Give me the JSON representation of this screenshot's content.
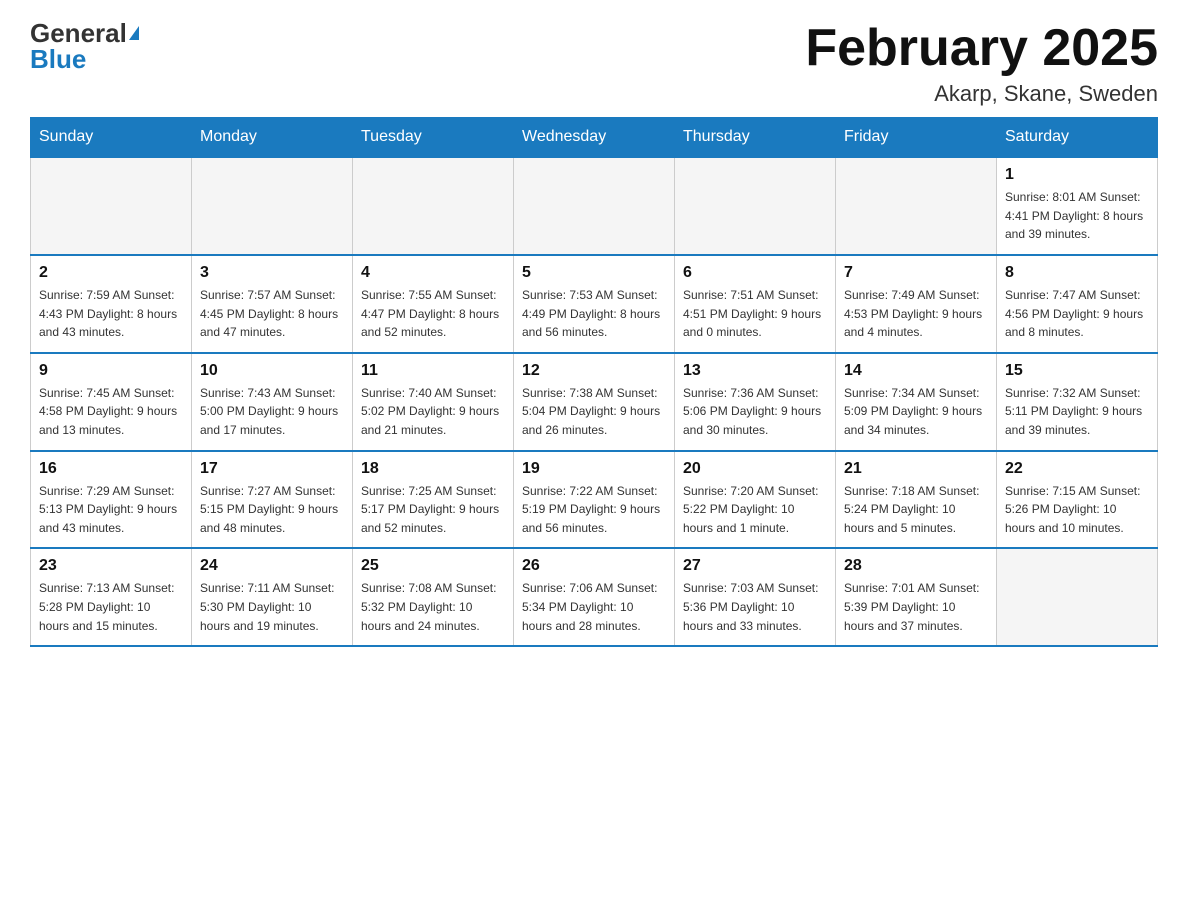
{
  "header": {
    "logo_general": "General",
    "logo_blue": "Blue",
    "month_title": "February 2025",
    "location": "Akarp, Skane, Sweden"
  },
  "days_of_week": [
    "Sunday",
    "Monday",
    "Tuesday",
    "Wednesday",
    "Thursday",
    "Friday",
    "Saturday"
  ],
  "weeks": [
    [
      {
        "day": "",
        "info": ""
      },
      {
        "day": "",
        "info": ""
      },
      {
        "day": "",
        "info": ""
      },
      {
        "day": "",
        "info": ""
      },
      {
        "day": "",
        "info": ""
      },
      {
        "day": "",
        "info": ""
      },
      {
        "day": "1",
        "info": "Sunrise: 8:01 AM\nSunset: 4:41 PM\nDaylight: 8 hours\nand 39 minutes."
      }
    ],
    [
      {
        "day": "2",
        "info": "Sunrise: 7:59 AM\nSunset: 4:43 PM\nDaylight: 8 hours\nand 43 minutes."
      },
      {
        "day": "3",
        "info": "Sunrise: 7:57 AM\nSunset: 4:45 PM\nDaylight: 8 hours\nand 47 minutes."
      },
      {
        "day": "4",
        "info": "Sunrise: 7:55 AM\nSunset: 4:47 PM\nDaylight: 8 hours\nand 52 minutes."
      },
      {
        "day": "5",
        "info": "Sunrise: 7:53 AM\nSunset: 4:49 PM\nDaylight: 8 hours\nand 56 minutes."
      },
      {
        "day": "6",
        "info": "Sunrise: 7:51 AM\nSunset: 4:51 PM\nDaylight: 9 hours\nand 0 minutes."
      },
      {
        "day": "7",
        "info": "Sunrise: 7:49 AM\nSunset: 4:53 PM\nDaylight: 9 hours\nand 4 minutes."
      },
      {
        "day": "8",
        "info": "Sunrise: 7:47 AM\nSunset: 4:56 PM\nDaylight: 9 hours\nand 8 minutes."
      }
    ],
    [
      {
        "day": "9",
        "info": "Sunrise: 7:45 AM\nSunset: 4:58 PM\nDaylight: 9 hours\nand 13 minutes."
      },
      {
        "day": "10",
        "info": "Sunrise: 7:43 AM\nSunset: 5:00 PM\nDaylight: 9 hours\nand 17 minutes."
      },
      {
        "day": "11",
        "info": "Sunrise: 7:40 AM\nSunset: 5:02 PM\nDaylight: 9 hours\nand 21 minutes."
      },
      {
        "day": "12",
        "info": "Sunrise: 7:38 AM\nSunset: 5:04 PM\nDaylight: 9 hours\nand 26 minutes."
      },
      {
        "day": "13",
        "info": "Sunrise: 7:36 AM\nSunset: 5:06 PM\nDaylight: 9 hours\nand 30 minutes."
      },
      {
        "day": "14",
        "info": "Sunrise: 7:34 AM\nSunset: 5:09 PM\nDaylight: 9 hours\nand 34 minutes."
      },
      {
        "day": "15",
        "info": "Sunrise: 7:32 AM\nSunset: 5:11 PM\nDaylight: 9 hours\nand 39 minutes."
      }
    ],
    [
      {
        "day": "16",
        "info": "Sunrise: 7:29 AM\nSunset: 5:13 PM\nDaylight: 9 hours\nand 43 minutes."
      },
      {
        "day": "17",
        "info": "Sunrise: 7:27 AM\nSunset: 5:15 PM\nDaylight: 9 hours\nand 48 minutes."
      },
      {
        "day": "18",
        "info": "Sunrise: 7:25 AM\nSunset: 5:17 PM\nDaylight: 9 hours\nand 52 minutes."
      },
      {
        "day": "19",
        "info": "Sunrise: 7:22 AM\nSunset: 5:19 PM\nDaylight: 9 hours\nand 56 minutes."
      },
      {
        "day": "20",
        "info": "Sunrise: 7:20 AM\nSunset: 5:22 PM\nDaylight: 10 hours\nand 1 minute."
      },
      {
        "day": "21",
        "info": "Sunrise: 7:18 AM\nSunset: 5:24 PM\nDaylight: 10 hours\nand 5 minutes."
      },
      {
        "day": "22",
        "info": "Sunrise: 7:15 AM\nSunset: 5:26 PM\nDaylight: 10 hours\nand 10 minutes."
      }
    ],
    [
      {
        "day": "23",
        "info": "Sunrise: 7:13 AM\nSunset: 5:28 PM\nDaylight: 10 hours\nand 15 minutes."
      },
      {
        "day": "24",
        "info": "Sunrise: 7:11 AM\nSunset: 5:30 PM\nDaylight: 10 hours\nand 19 minutes."
      },
      {
        "day": "25",
        "info": "Sunrise: 7:08 AM\nSunset: 5:32 PM\nDaylight: 10 hours\nand 24 minutes."
      },
      {
        "day": "26",
        "info": "Sunrise: 7:06 AM\nSunset: 5:34 PM\nDaylight: 10 hours\nand 28 minutes."
      },
      {
        "day": "27",
        "info": "Sunrise: 7:03 AM\nSunset: 5:36 PM\nDaylight: 10 hours\nand 33 minutes."
      },
      {
        "day": "28",
        "info": "Sunrise: 7:01 AM\nSunset: 5:39 PM\nDaylight: 10 hours\nand 37 minutes."
      },
      {
        "day": "",
        "info": ""
      }
    ]
  ]
}
